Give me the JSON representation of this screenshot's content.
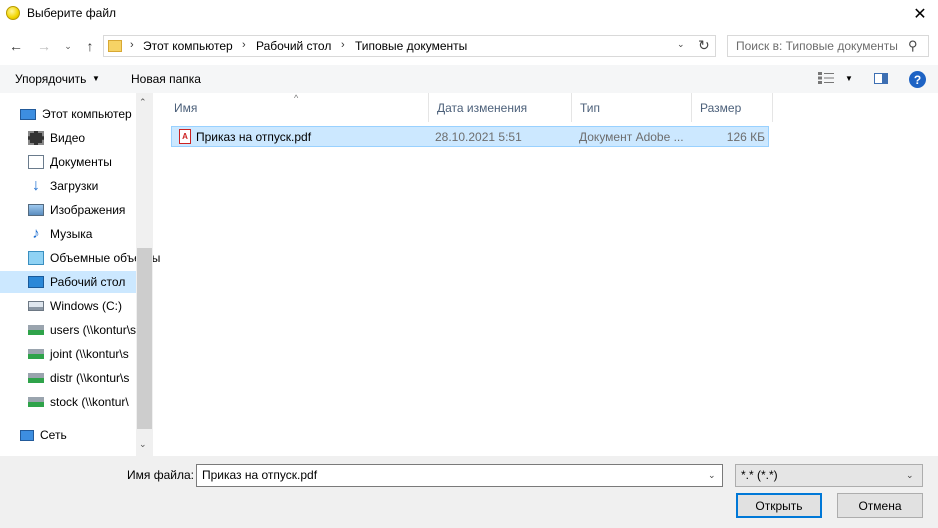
{
  "window": {
    "title": "Выберите файл",
    "close_glyph": "✕"
  },
  "nav": {
    "back_glyph": "←",
    "forward_glyph": "→",
    "recent_glyph": "⌄",
    "up_glyph": "↑",
    "breadcrumbs": [
      "Этот компьютер",
      "Рабочий стол",
      "Типовые документы"
    ],
    "crumb_sep": "›",
    "dropdown_glyph": "⌄",
    "refresh_glyph": "↻",
    "search_placeholder": "Поиск в: Типовые документы",
    "search_glyph": "⚲"
  },
  "toolbar": {
    "organize_label": "Упорядочить",
    "newfolder_label": "Новая папка",
    "caret_glyph": "▼",
    "help_glyph": "?"
  },
  "sidebar": {
    "items": [
      {
        "label": "Этот компьютер",
        "icon": "computer-icon"
      },
      {
        "label": "Видео",
        "icon": "video-icon"
      },
      {
        "label": "Документы",
        "icon": "documents-icon"
      },
      {
        "label": "Загрузки",
        "icon": "downloads-icon"
      },
      {
        "label": "Изображения",
        "icon": "pictures-icon"
      },
      {
        "label": "Музыка",
        "icon": "music-icon"
      },
      {
        "label": "Объемные объекты",
        "icon": "3d-objects-icon"
      },
      {
        "label": "Рабочий стол",
        "icon": "desktop-icon",
        "selected": true
      },
      {
        "label": "Windows (C:)",
        "icon": "drive-icon"
      },
      {
        "label": "users (\\\\kontur\\s",
        "icon": "network-drive-icon"
      },
      {
        "label": "joint (\\\\kontur\\s",
        "icon": "network-drive-icon"
      },
      {
        "label": "distr (\\\\kontur\\s",
        "icon": "network-drive-icon"
      },
      {
        "label": "stock (\\\\kontur\\",
        "icon": "network-drive-icon"
      },
      {
        "label": "Сеть",
        "icon": "network-icon"
      }
    ],
    "scroll_up_glyph": "⌃",
    "scroll_down_glyph": "⌄"
  },
  "filelist": {
    "columns": [
      "Имя",
      "Дата изменения",
      "Тип",
      "Размер"
    ],
    "sort_glyph": "^",
    "rows": [
      {
        "name": "Приказ на отпуск.pdf",
        "modified": "28.10.2021 5:51",
        "type": "Документ Adobe ...",
        "size": "126 КБ",
        "icon_text": "A"
      }
    ]
  },
  "footer": {
    "filename_label": "Имя файла:",
    "filename_value": "Приказ на отпуск.pdf",
    "filter_value": "*.* (*.*)",
    "open_label": "Открыть",
    "cancel_label": "Отмена"
  },
  "colors": {
    "accent": "#0078d7",
    "selection": "#cce8ff",
    "header_text": "#4c607a"
  }
}
